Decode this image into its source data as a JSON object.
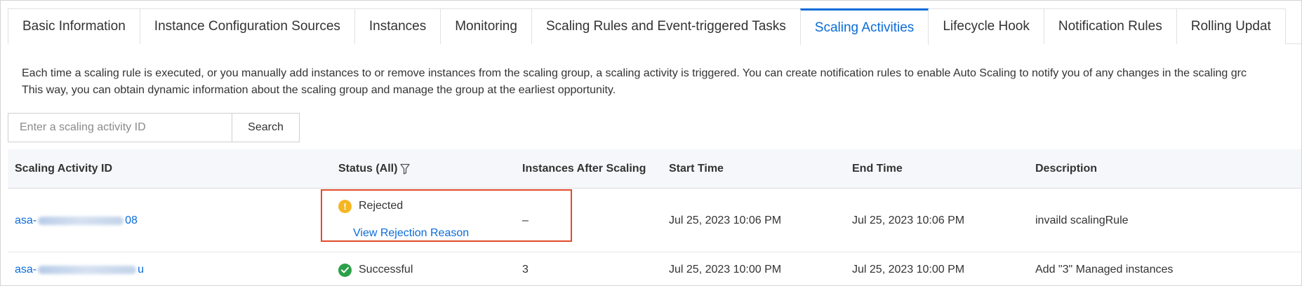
{
  "tabs": [
    {
      "label": "Basic Information",
      "active": false
    },
    {
      "label": "Instance Configuration Sources",
      "active": false
    },
    {
      "label": "Instances",
      "active": false
    },
    {
      "label": "Monitoring",
      "active": false
    },
    {
      "label": "Scaling Rules and Event-triggered Tasks",
      "active": false
    },
    {
      "label": "Scaling Activities",
      "active": true
    },
    {
      "label": "Lifecycle Hook",
      "active": false
    },
    {
      "label": "Notification Rules",
      "active": false
    },
    {
      "label": "Rolling Updat",
      "active": false
    }
  ],
  "description": {
    "line1": "Each time a scaling rule is executed, or you manually add instances to or remove instances from the scaling group, a scaling activity is triggered. You can create notification rules to enable Auto Scaling to notify you of any changes in the scaling grc",
    "line2": "This way, you can obtain dynamic information about the scaling group and manage the group at the earliest opportunity."
  },
  "search": {
    "placeholder": "Enter a scaling activity ID",
    "button_label": "Search"
  },
  "table": {
    "headers": {
      "id": "Scaling Activity ID",
      "status": "Status (All)",
      "instances": "Instances After Scaling",
      "start": "Start Time",
      "end": "End Time",
      "description": "Description"
    },
    "rows": [
      {
        "id_prefix": "asa-",
        "id_suffix": "08",
        "status": "Rejected",
        "status_link": "View Rejection Reason",
        "instances": "–",
        "start": "Jul 25, 2023 10:06 PM",
        "end": "Jul 25, 2023 10:06 PM",
        "description": "invaild scalingRule"
      },
      {
        "id_prefix": "asa-",
        "id_suffix": "u",
        "status": "Successful",
        "instances": "3",
        "start": "Jul 25, 2023 10:00 PM",
        "end": "Jul 25, 2023 10:00 PM",
        "description": "Add \"3\" Managed instances"
      }
    ]
  },
  "colors": {
    "accent": "#0a6cd8",
    "warning": "#f5b624",
    "success": "#2aa148",
    "highlight": "#e24a2b"
  },
  "icons": {
    "warning": "exclamation-circle-icon",
    "success": "check-circle-icon",
    "filter": "filter-icon"
  }
}
